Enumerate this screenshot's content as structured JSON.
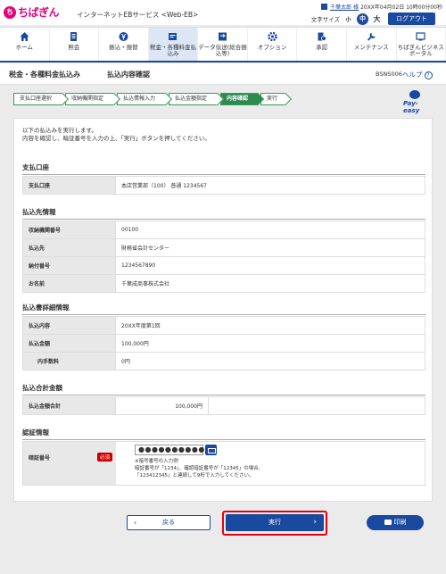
{
  "header": {
    "logo_mark": "ち",
    "logo_text": "ちばぎん",
    "service_name": "インターネットEBサービス <Web-EB>",
    "user_name": "千葉太郎 様",
    "datetime": "20XX年04月02日 10時00分00秒",
    "text_size_label": "文字サイズ",
    "text_size_small": "小",
    "text_size_mid": "中",
    "text_size_large": "大",
    "logout_label": "ログアウト"
  },
  "nav": {
    "items": [
      {
        "label": "ホーム"
      },
      {
        "label": "照会"
      },
      {
        "label": "振込・振替"
      },
      {
        "label": "税金・各種料金払込み"
      },
      {
        "label": "データ伝送(総合振込等)"
      },
      {
        "label": "オプション"
      },
      {
        "label": "承認"
      },
      {
        "label": "メンテナンス"
      },
      {
        "label": "ちばぎんビジネスポータル"
      }
    ]
  },
  "titlebar": {
    "title": "税金・各種料金払込み",
    "subtitle": "払込内容確認",
    "screen_code": "BSNS006",
    "help_label": "ヘルプ"
  },
  "steps": [
    {
      "label": "支払口座選択"
    },
    {
      "label": "収納機関指定"
    },
    {
      "label": "払込情報入力"
    },
    {
      "label": "払込金額指定"
    },
    {
      "label": "内容確認"
    },
    {
      "label": "実行"
    }
  ],
  "payeasy_label": "Pay-easy",
  "intro": {
    "line1": "以下の払込みを実行します。",
    "line2": "内容を確認し、暗証番号を入力の上、「実行」ボタンを押してください。"
  },
  "account": {
    "title": "支払口座",
    "label": "支払口座",
    "value": "本店営業部（100） 普通 1234567"
  },
  "payee": {
    "title": "払込先情報",
    "rows": [
      {
        "label": "収納機関番号",
        "value": "00100"
      },
      {
        "label": "払込先",
        "value": "財務省会計センター"
      },
      {
        "label": "納付番号",
        "value": "1234567890"
      },
      {
        "label": "お名前",
        "value": "千葉成商事株式会社"
      }
    ]
  },
  "detail": {
    "title": "払込書詳細情報",
    "rows": [
      {
        "label": "払込内容",
        "value": "20XX年度第1回"
      },
      {
        "label": "払込金額",
        "value": "100,000円"
      },
      {
        "label": "内手数料",
        "value": "0円"
      }
    ]
  },
  "total": {
    "title": "払込合計金額",
    "label": "払込金額合計",
    "value": "100,000円"
  },
  "auth": {
    "title": "認証情報",
    "label": "暗証番号",
    "required": "必須",
    "password_masked": "●●●●●●●●●●",
    "note1": "※暗号番号の入力例",
    "note2": "暗証番号が「1234」、確認暗証番号が「12345」の場合、",
    "note3": "「123412345」と連続して9桁で入力してください。"
  },
  "buttons": {
    "back": "戻る",
    "execute": "実行",
    "print": "印刷"
  },
  "colors": {
    "brand": "#e4007f",
    "primary": "#1a4aa0",
    "step_green": "#2e8b4f",
    "highlight_red": "#e60012"
  }
}
